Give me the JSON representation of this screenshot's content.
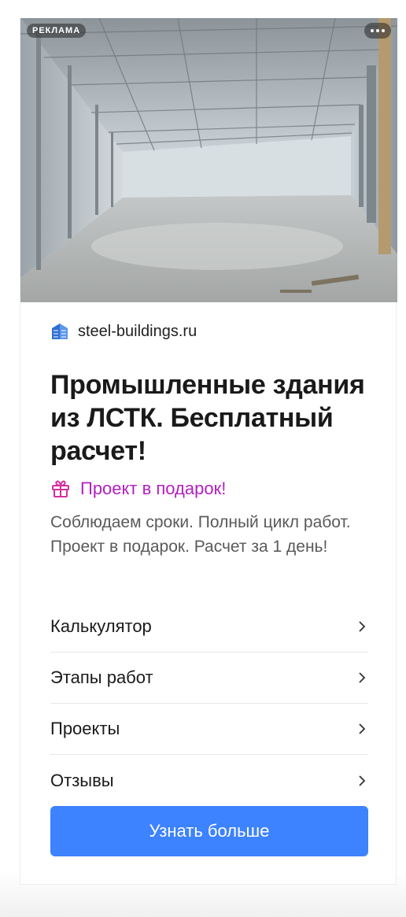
{
  "ad": {
    "label": "РЕКЛАМА",
    "domain": "steel-buildings.ru",
    "headline": "Промышленные здания из ЛСТК. Бесплатный расчет!",
    "promo": "Проект в подарок!",
    "description": "Соблюдаем сроки. Полный цикл работ. Проект в подарок. Расчет за 1 день!",
    "links": [
      {
        "label": "Калькулятор"
      },
      {
        "label": "Этапы работ"
      },
      {
        "label": "Проекты"
      },
      {
        "label": "Отзывы"
      }
    ],
    "cta": "Узнать больше"
  },
  "icons": {
    "domain": "building-icon",
    "promo": "gift-icon",
    "menu": "more-dots-icon",
    "link_arrow": "chevron-right-icon"
  },
  "colors": {
    "cta_background": "#3d82ff",
    "promo_text": "#b21fbf",
    "headline_text": "#1a1a1a",
    "description_text": "#5a5a5a"
  }
}
